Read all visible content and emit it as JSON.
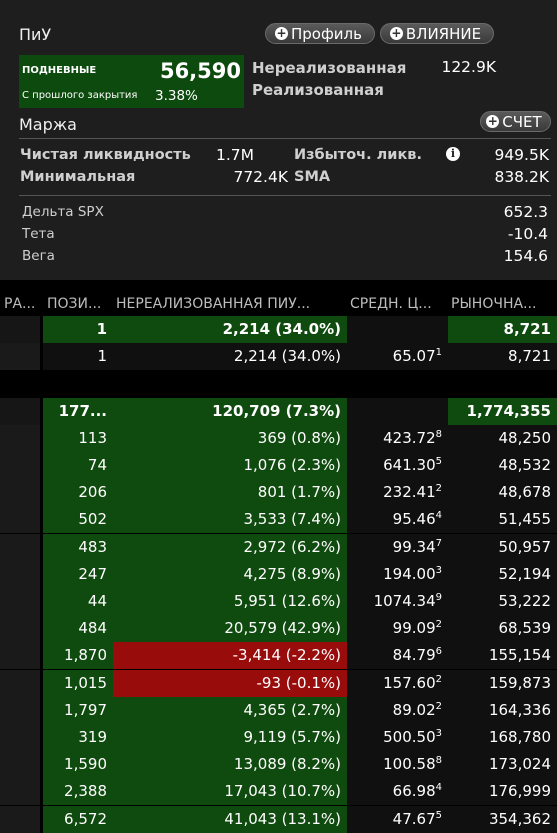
{
  "header": {
    "title": "ПиУ",
    "profile_label": "Профиль",
    "impact_label": "ВЛИЯНИЕ"
  },
  "pnl": {
    "daily_label": "ПОДНЕВНЫЕ",
    "daily_value": "56,590",
    "since_close_label": "С прошлого закрытия",
    "since_close_value": "3.38%",
    "unrealized_label": "Нереализованная",
    "unrealized_value": "122.9K",
    "realized_label": "Реализованная"
  },
  "margin": {
    "title": "Маржа",
    "account_label": "СЧЕТ",
    "net_liq_label": "Чистая ликвидность",
    "net_liq_value": "1.7M",
    "excess_liq_label": "Избыточ. ликв.",
    "excess_liq_value": "949.5K",
    "minimum_label": "Минимальная",
    "minimum_value": "772.4K",
    "sma_label": "SMA",
    "sma_value": "838.2K"
  },
  "greeks": {
    "delta_label": "Дельта SPX",
    "delta_value": "652.3",
    "theta_label": "Тета",
    "theta_value": "-10.4",
    "vega_label": "Вега",
    "vega_value": "154.6"
  },
  "table": {
    "columns": [
      "РА...",
      "ПОЗИ...",
      "НЕРЕАЛИЗОВАННАЯ ПИУ...",
      "СРЕДН. Ц...",
      "РЫНОЧНА..."
    ],
    "rows": [
      {
        "pos": "1",
        "pnl": "2,214 (34.0%)",
        "avg": "",
        "sup": "",
        "mkt": "8,721",
        "style": "group"
      },
      {
        "pos": "1",
        "pnl": "2,214 (34.0%)",
        "avg": "65.07",
        "sup": "1",
        "mkt": "8,721",
        "style": "normal"
      },
      {
        "pos": "",
        "pnl": "",
        "avg": "",
        "sup": "",
        "mkt": "",
        "style": "blank"
      },
      {
        "pos": "177...",
        "pnl": "120,709 (7.3%)",
        "avg": "",
        "sup": "",
        "mkt": "1,774,355",
        "style": "group"
      },
      {
        "pos": "113",
        "pnl": "369 (0.8%)",
        "avg": "423.72",
        "sup": "8",
        "mkt": "48,250",
        "style": "pos"
      },
      {
        "pos": "74",
        "pnl": "1,076 (2.3%)",
        "avg": "641.30",
        "sup": "5",
        "mkt": "48,532",
        "style": "pos"
      },
      {
        "pos": "206",
        "pnl": "801 (1.7%)",
        "avg": "232.41",
        "sup": "2",
        "mkt": "48,678",
        "style": "pos"
      },
      {
        "pos": "502",
        "pnl": "3,533 (7.4%)",
        "avg": "95.46",
        "sup": "4",
        "mkt": "51,455",
        "style": "pos"
      },
      {
        "pos": "483",
        "pnl": "2,972 (6.2%)",
        "avg": "99.34",
        "sup": "7",
        "mkt": "50,957",
        "style": "pos"
      },
      {
        "pos": "247",
        "pnl": "4,275 (8.9%)",
        "avg": "194.00",
        "sup": "3",
        "mkt": "52,194",
        "style": "pos"
      },
      {
        "pos": "44",
        "pnl": "5,951 (12.6%)",
        "avg": "1074.34",
        "sup": "9",
        "mkt": "53,222",
        "style": "pos"
      },
      {
        "pos": "484",
        "pnl": "20,579 (42.9%)",
        "avg": "99.09",
        "sup": "2",
        "mkt": "68,539",
        "style": "pos"
      },
      {
        "pos": "1,870",
        "pnl": "-3,414 (-2.2%)",
        "avg": "84.79",
        "sup": "6",
        "mkt": "155,154",
        "style": "neg"
      },
      {
        "pos": "1,015",
        "pnl": "-93 (-0.1%)",
        "avg": "157.60",
        "sup": "2",
        "mkt": "159,873",
        "style": "neg"
      },
      {
        "pos": "1,797",
        "pnl": "4,365 (2.7%)",
        "avg": "89.02",
        "sup": "2",
        "mkt": "164,336",
        "style": "pos"
      },
      {
        "pos": "319",
        "pnl": "9,119 (5.7%)",
        "avg": "500.50",
        "sup": "3",
        "mkt": "168,780",
        "style": "pos"
      },
      {
        "pos": "1,590",
        "pnl": "13,089 (8.2%)",
        "avg": "100.58",
        "sup": "8",
        "mkt": "173,024",
        "style": "pos"
      },
      {
        "pos": "2,388",
        "pnl": "17,043 (10.7%)",
        "avg": "66.98",
        "sup": "4",
        "mkt": "176,999",
        "style": "pos"
      },
      {
        "pos": "6,572",
        "pnl": "41,043 (13.1%)",
        "avg": "47.67",
        "sup": "5",
        "mkt": "354,362",
        "style": "pos"
      }
    ]
  },
  "colors": {
    "positive_bg": "#0f4a0f",
    "negative_bg": "#990c0c",
    "panel_bg": "#1e1e1e"
  },
  "icons": {
    "plus": "plus-icon",
    "info": "info-icon"
  }
}
